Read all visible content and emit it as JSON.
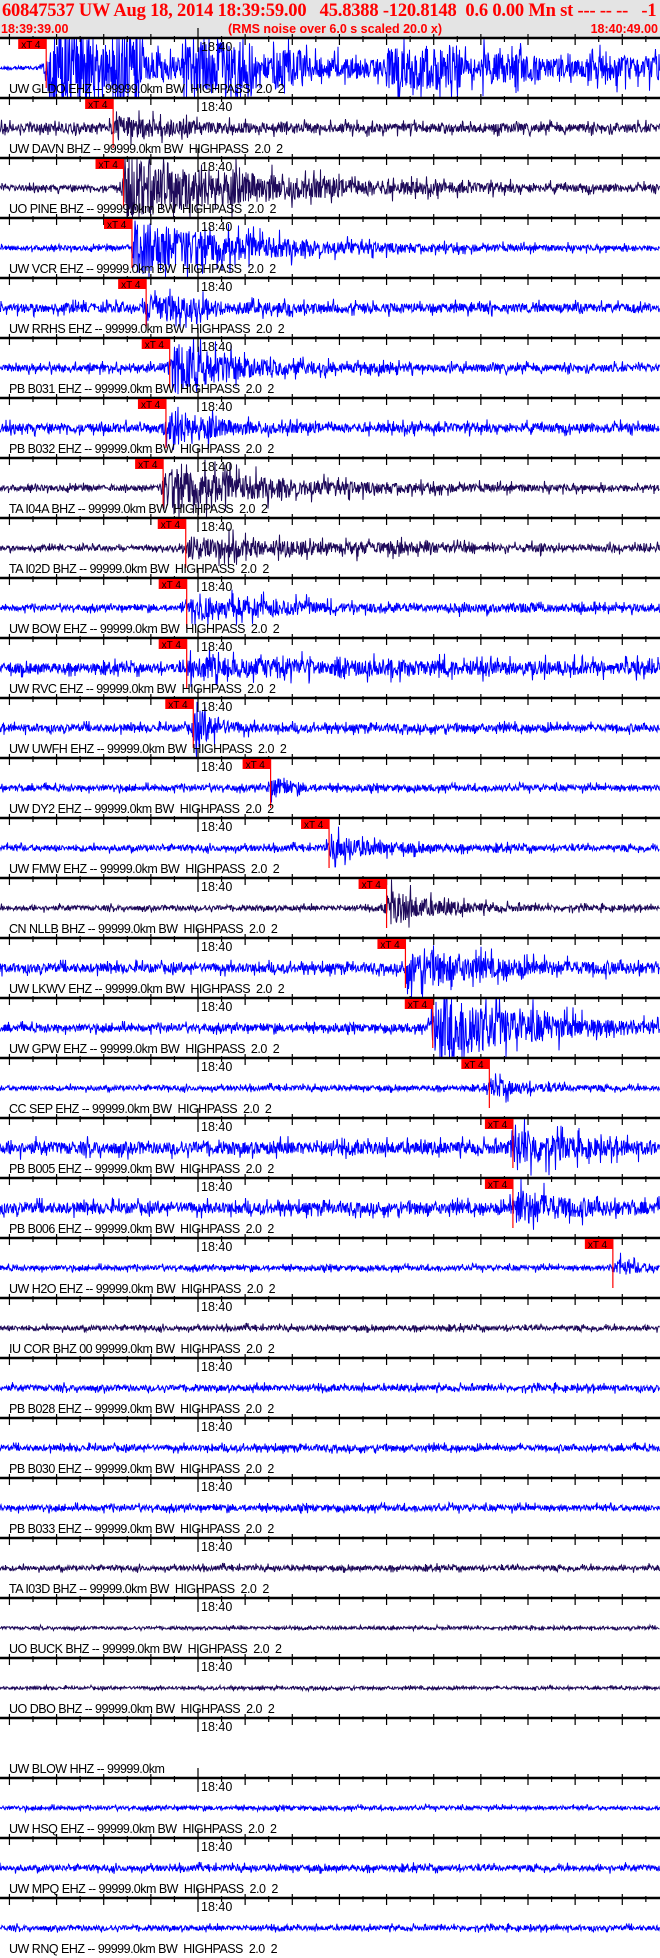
{
  "header": {
    "title": "60847537 UW Aug 18, 2014 18:39:59.00   45.8388 -120.8148  0.6 0.00 Mn st --- -- --   -1",
    "start_time": "18:39:39.00",
    "note": "(RMS noise over 6.0 s scaled 20.0 x)",
    "end_time": "18:40:49.00"
  },
  "colors": {
    "header_bg": "#e4e4e4",
    "header_text": "#ff0000",
    "trace_blue": "#0000ff",
    "trace_dark": "#1e0a5a",
    "pick": "#ff0000"
  },
  "chart_data": {
    "type": "line",
    "title": "Seismogram record section",
    "time_window_s": [
      0,
      70
    ],
    "start_time": "18:39:39.00",
    "major_tick_s": 5,
    "minor_tick_s": 2.5,
    "tick_label": "18:40",
    "tick_label_time_s": 21,
    "pick_label": "xT 4",
    "stations": [
      {
        "label": "UW GLDO EHZ -- 99999.0km BW  HIGHPASS  2.0  2",
        "color": "blue",
        "pick_s": 4.9,
        "noise": 0.08,
        "event": 1.6,
        "decay_s": 60,
        "bursty": true
      },
      {
        "label": "UW DAVN BHZ -- 99999.0km BW  HIGHPASS  2.0  2",
        "color": "dark",
        "pick_s": 12.0,
        "noise": 0.18,
        "event": 0.4,
        "decay_s": 6
      },
      {
        "label": "UO PINE BHZ -- 99999.0km BW  HIGHPASS  2.0  2",
        "color": "dark",
        "pick_s": 13.1,
        "noise": 0.12,
        "event": 1.3,
        "decay_s": 14
      },
      {
        "label": "UW VCR EHZ -- 99999.0km BW  HIGHPASS  2.0  2",
        "color": "blue",
        "pick_s": 14.0,
        "noise": 0.1,
        "event": 1.1,
        "decay_s": 12
      },
      {
        "label": "UW RRHS EHZ -- 99999.0km BW  HIGHPASS  2.0  2",
        "color": "blue",
        "pick_s": 15.5,
        "noise": 0.18,
        "event": 0.6,
        "decay_s": 5
      },
      {
        "label": "PB B031 EHZ -- 99999.0km BW  HIGHPASS  2.0  2",
        "color": "blue",
        "pick_s": 18.0,
        "noise": 0.15,
        "event": 1.1,
        "decay_s": 6
      },
      {
        "label": "PB B032 EHZ -- 99999.0km BW  HIGHPASS  2.0  2",
        "color": "blue",
        "pick_s": 17.6,
        "noise": 0.18,
        "event": 0.8,
        "decay_s": 4
      },
      {
        "label": "TA I04A BHZ -- 99999.0km BW  HIGHPASS  2.0  2",
        "color": "dark",
        "pick_s": 17.3,
        "noise": 0.12,
        "event": 0.8,
        "decay_s": 12
      },
      {
        "label": "TA I02D BHZ -- 99999.0km BW  HIGHPASS  2.0  2",
        "color": "dark",
        "pick_s": 19.7,
        "noise": 0.1,
        "event": 0.4,
        "decay_s": 20,
        "bursty": true
      },
      {
        "label": "UW BOW EHZ -- 99999.0km BW  HIGHPASS  2.0  2",
        "color": "blue",
        "pick_s": 19.8,
        "noise": 0.12,
        "event": 0.35,
        "decay_s": 20,
        "bursty": true
      },
      {
        "label": "UW RVC EHZ -- 99999.0km BW  HIGHPASS  2.0  2",
        "color": "blue",
        "pick_s": 19.8,
        "noise": 0.2,
        "event": 0.4,
        "decay_s": 30,
        "bursty": true
      },
      {
        "label": "UW UWFH EHZ -- 99999.0km BW  HIGHPASS  2.0  2",
        "color": "blue",
        "pick_s": 20.5,
        "noise": 0.15,
        "event": 0.9,
        "decay_s": 2
      },
      {
        "label": "UW DY2 EHZ -- 99999.0km BW  HIGHPASS  2.0  2",
        "color": "blue",
        "pick_s": 28.7,
        "noise": 0.12,
        "event": 0.5,
        "decay_s": 1.5
      },
      {
        "label": "UW FMW EHZ -- 99999.0km BW  HIGHPASS  2.0  2",
        "color": "blue",
        "pick_s": 34.9,
        "noise": 0.12,
        "event": 0.45,
        "decay_s": 5
      },
      {
        "label": "CN NLLB BHZ -- 99999.0km BW  HIGHPASS  2.0  2",
        "color": "dark",
        "pick_s": 41.0,
        "noise": 0.1,
        "event": 0.7,
        "decay_s": 5
      },
      {
        "label": "UW LKWV EHZ -- 99999.0km BW  HIGHPASS  2.0  2",
        "color": "blue",
        "pick_s": 43.0,
        "noise": 0.18,
        "event": 0.6,
        "decay_s": 10
      },
      {
        "label": "UW GPW EHZ -- 99999.0km BW  HIGHPASS  2.0  2",
        "color": "blue",
        "pick_s": 45.9,
        "noise": 0.15,
        "event": 1.5,
        "decay_s": 9
      },
      {
        "label": "CC SEP EHZ -- 99999.0km BW  HIGHPASS  2.0  2",
        "color": "blue",
        "pick_s": 51.9,
        "noise": 0.1,
        "event": 0.35,
        "decay_s": 4
      },
      {
        "label": "PB B005 EHZ -- 99999.0km BW  HIGHPASS  2.0  2",
        "color": "blue",
        "pick_s": 54.4,
        "noise": 0.25,
        "event": 0.7,
        "decay_s": 5
      },
      {
        "label": "PB B006 EHZ -- 99999.0km BW  HIGHPASS  2.0  2",
        "color": "blue",
        "pick_s": 54.4,
        "noise": 0.22,
        "event": 0.7,
        "decay_s": 5
      },
      {
        "label": "UW H2O EHZ -- 99999.0km BW  HIGHPASS  2.0  2",
        "color": "blue",
        "pick_s": 65.0,
        "noise": 0.1,
        "event": 0.3,
        "decay_s": 3
      },
      {
        "label": "IU COR BHZ 00 99999.0km BW  HIGHPASS  2.0  2",
        "color": "dark",
        "noise": 0.1
      },
      {
        "label": "PB B028 EHZ -- 99999.0km BW  HIGHPASS  2.0  2",
        "color": "blue",
        "noise": 0.12
      },
      {
        "label": "PB B030 EHZ -- 99999.0km BW  HIGHPASS  2.0  2",
        "color": "blue",
        "noise": 0.12
      },
      {
        "label": "PB B033 EHZ -- 99999.0km BW  HIGHPASS  2.0  2",
        "color": "blue",
        "noise": 0.12
      },
      {
        "label": "TA I03D BHZ -- 99999.0km BW  HIGHPASS  2.0  2",
        "color": "dark",
        "noise": 0.1
      },
      {
        "label": "UO BUCK BHZ -- 99999.0km BW  HIGHPASS  2.0  2",
        "color": "dark",
        "noise": 0.06
      },
      {
        "label": "UO DBO BHZ -- 99999.0km BW  HIGHPASS  2.0  2",
        "color": "dark",
        "noise": 0.06
      },
      {
        "label": "UW BLOW HHZ -- 99999.0km",
        "color": "none"
      },
      {
        "label": "UW HSQ EHZ -- 99999.0km BW  HIGHPASS  2.0  2",
        "color": "blue",
        "noise": 0.08
      },
      {
        "label": "UW MPQ EHZ -- 99999.0km BW  HIGHPASS  2.0  2",
        "color": "blue",
        "noise": 0.12
      },
      {
        "label": "UW RNQ EHZ -- 99999.0km BW  HIGHPASS  2.0  2",
        "color": "blue",
        "noise": 0.1
      }
    ]
  }
}
